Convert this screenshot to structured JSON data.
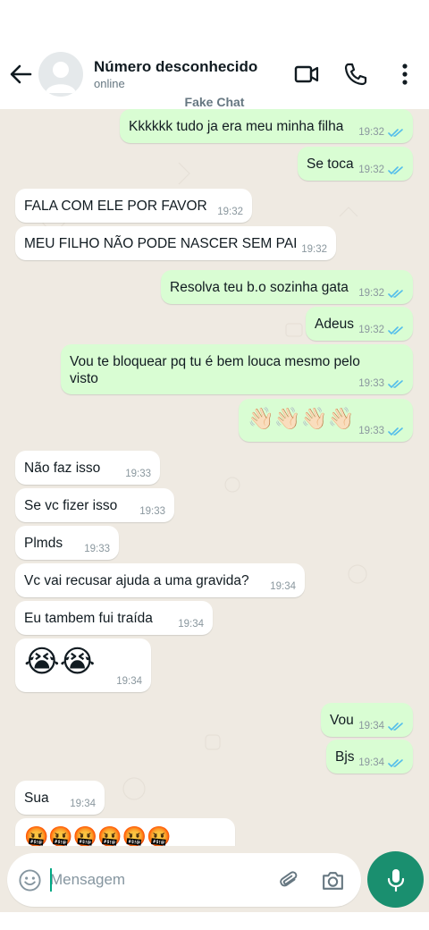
{
  "header": {
    "contact_name": "Número desconhecido",
    "status": "online",
    "icons": [
      "back-arrow-icon",
      "avatar-placeholder",
      "video-call-icon",
      "phone-icon",
      "more-options-icon"
    ]
  },
  "chat": {
    "caption": "Fake Chat",
    "colors": {
      "out_bubble": "#d9fdd3",
      "in_bubble": "#ffffff",
      "read_ticks": "#53bdeb",
      "background": "#efeae2"
    },
    "messages": [
      {
        "dir": "out",
        "text": "Kkkkkk tudo ja era meu minha filha",
        "time": "19:32",
        "read": true
      },
      {
        "dir": "out",
        "text": "Se toca",
        "time": "19:32",
        "read": true
      },
      {
        "dir": "in",
        "text": "FALA COM ELE POR FAVOR",
        "time": "19:32"
      },
      {
        "dir": "in",
        "text": "MEU FILHO NÃO PODE NASCER SEM PAI",
        "time": "19:32"
      },
      {
        "dir": "out",
        "text": "Resolva teu b.o sozinha gata",
        "time": "19:32",
        "read": true
      },
      {
        "dir": "out",
        "text": "Adeus",
        "time": "19:32",
        "read": true
      },
      {
        "dir": "out",
        "text": "Vou te bloquear pq tu é bem louca mesmo pelo visto",
        "time": "19:33",
        "read": true
      },
      {
        "dir": "out",
        "text": "👋🏻👋🏻👋🏻👋🏻",
        "time": "19:33",
        "read": true
      },
      {
        "dir": "in",
        "text": "Não faz isso",
        "time": "19:33"
      },
      {
        "dir": "in",
        "text": "Se vc fizer isso",
        "time": "19:33"
      },
      {
        "dir": "in",
        "text": "Plmds",
        "time": "19:33"
      },
      {
        "dir": "in",
        "text": "Vc vai recusar ajuda a uma gravida?",
        "time": "19:34"
      },
      {
        "dir": "in",
        "text": "Eu tambem fui traída",
        "time": "19:34"
      },
      {
        "dir": "in",
        "text": "😭😭",
        "time": "19:34"
      },
      {
        "dir": "out",
        "text": "Vou",
        "time": "19:34",
        "read": true
      },
      {
        "dir": "out",
        "text": "Bjs",
        "time": "19:34",
        "read": true
      },
      {
        "dir": "in",
        "text": "Sua",
        "time": "19:34"
      },
      {
        "dir": "in",
        "text": "🤬🤬🤬🤬🤬🤬",
        "time": ""
      }
    ]
  },
  "composer": {
    "placeholder": "Mensagem",
    "icons": [
      "emoji-icon",
      "attach-icon",
      "camera-icon",
      "mic-icon"
    ]
  }
}
